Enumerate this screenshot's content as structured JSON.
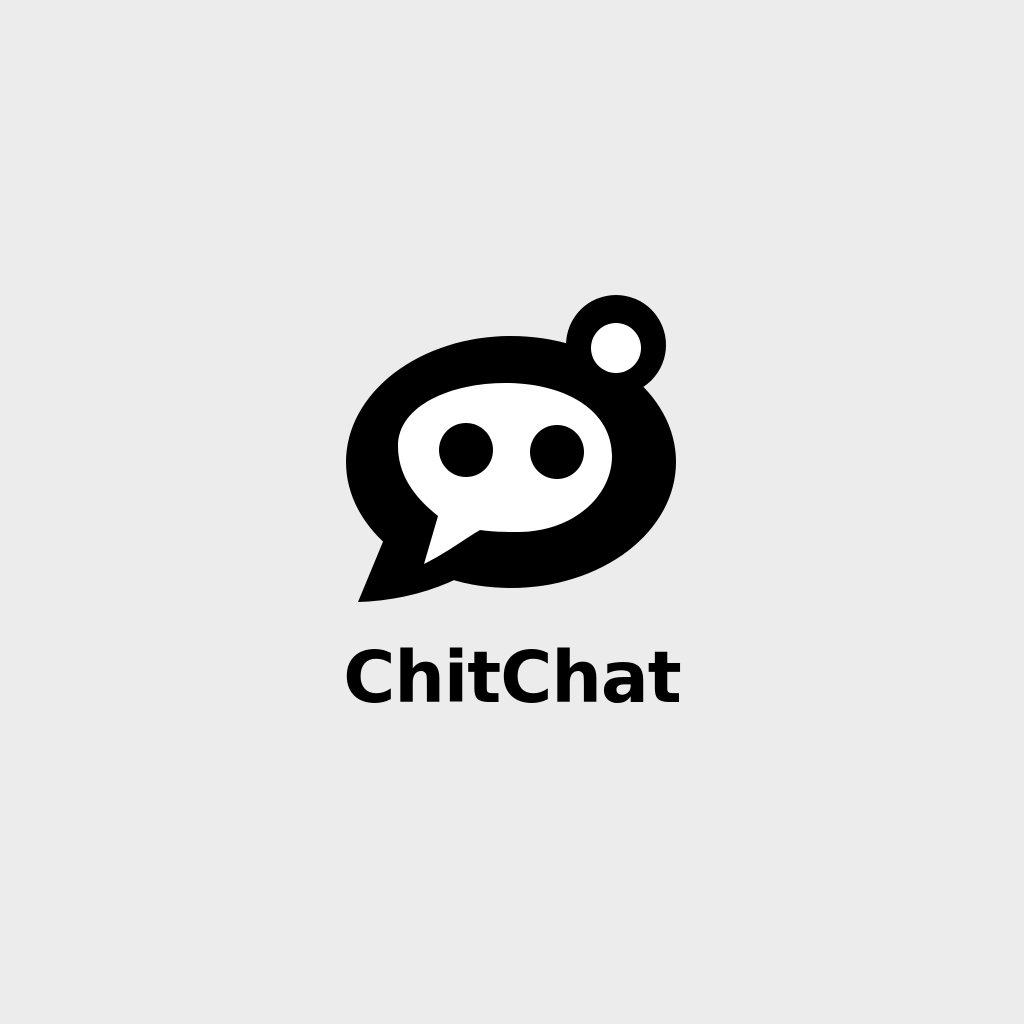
{
  "brand": {
    "name": "ChitChat",
    "logo_icon": "speech-bubble-face-icon"
  },
  "colors": {
    "background": "#ececec",
    "mark": "#000000",
    "inner": "#ffffff"
  }
}
